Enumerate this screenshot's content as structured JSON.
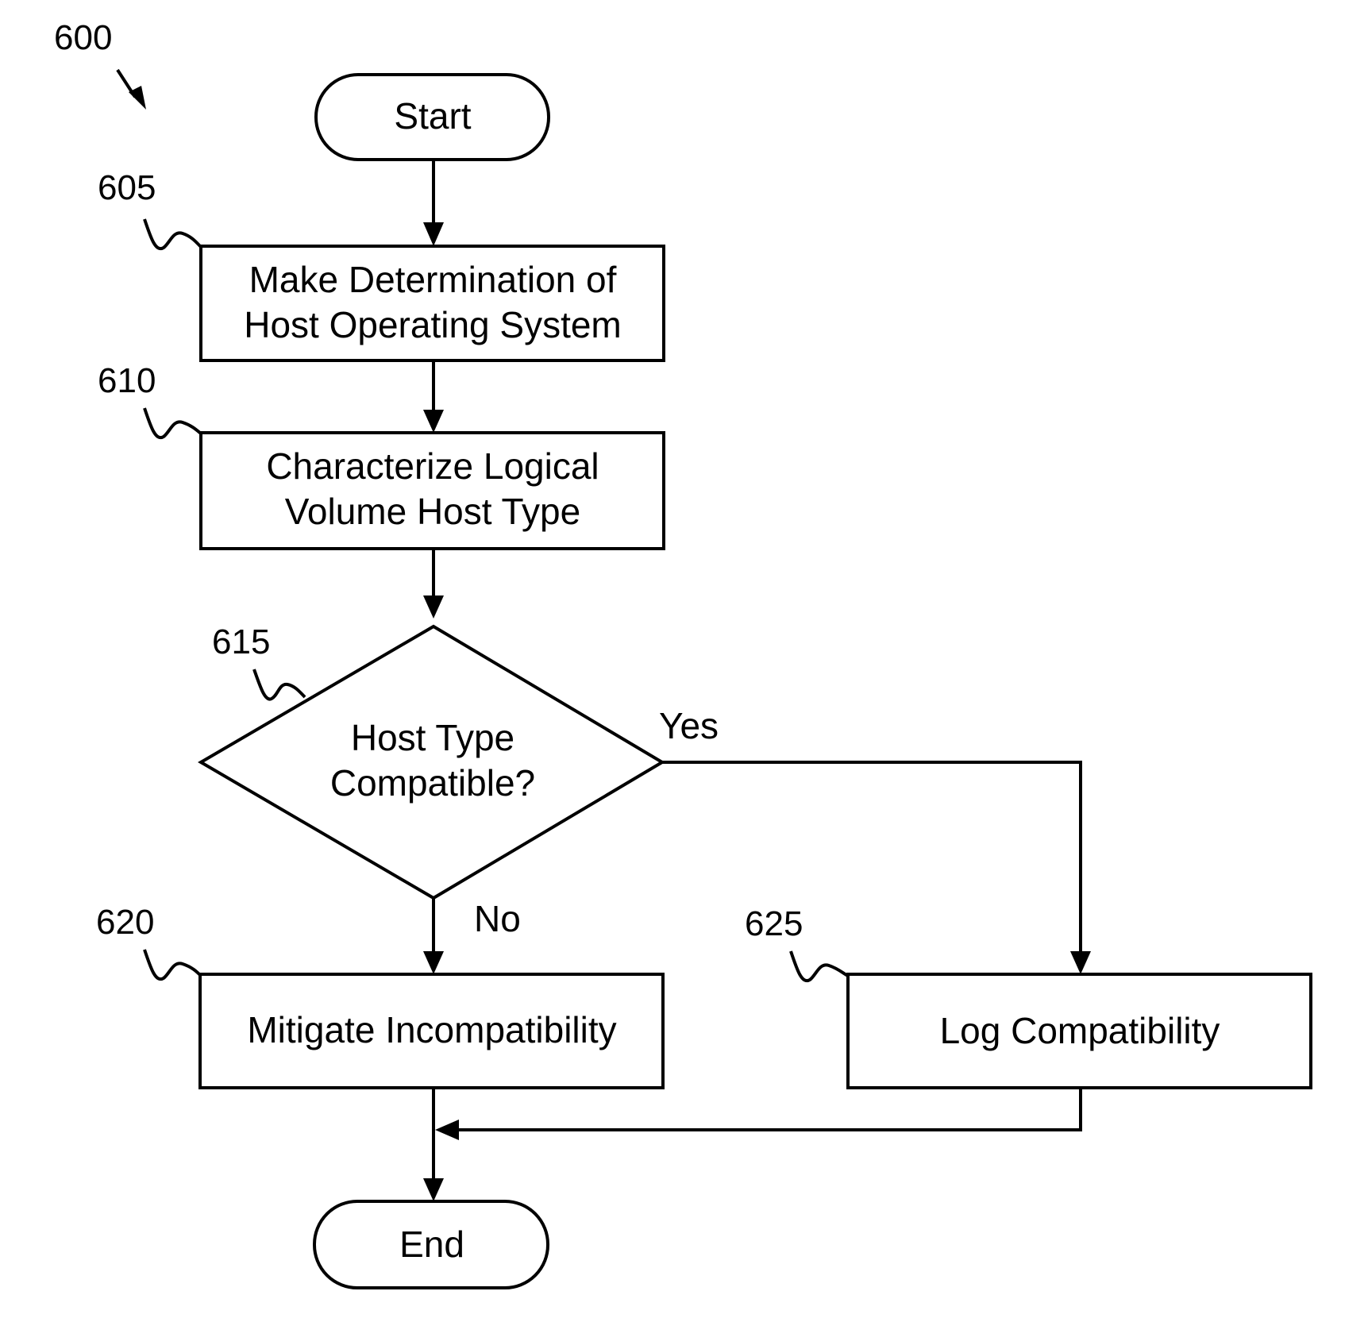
{
  "figure": {
    "ref": "600",
    "nodes": {
      "start": {
        "label": "Start"
      },
      "n605": {
        "ref": "605",
        "lines": [
          "Make Determination of",
          "Host Operating System"
        ]
      },
      "n610": {
        "ref": "610",
        "lines": [
          "Characterize Logical",
          "Volume Host Type"
        ]
      },
      "n615": {
        "ref": "615",
        "lines": [
          "Host Type",
          "Compatible?"
        ]
      },
      "n620": {
        "ref": "620",
        "lines": [
          "Mitigate Incompatibility"
        ]
      },
      "n625": {
        "ref": "625",
        "lines": [
          "Log Compatibility"
        ]
      },
      "end": {
        "label": "End"
      }
    },
    "edges": {
      "yes_label": "Yes",
      "no_label": "No"
    }
  }
}
